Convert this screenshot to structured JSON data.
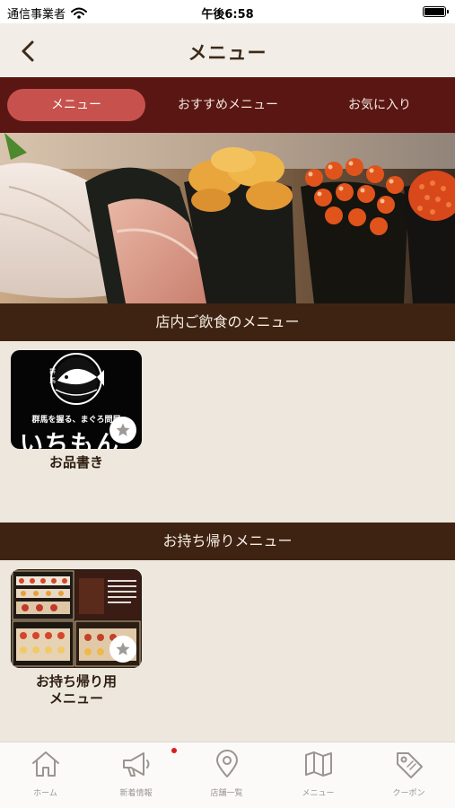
{
  "status_bar": {
    "carrier": "通信事業者",
    "time": "午後6:58"
  },
  "nav": {
    "title": "メニュー"
  },
  "segments": [
    {
      "label": "メニュー",
      "active": true
    },
    {
      "label": "おすすめメニュー",
      "active": false
    },
    {
      "label": "お気に入り",
      "active": false
    }
  ],
  "sections": [
    {
      "title": "店内ご飲食のメニュー",
      "items": [
        {
          "name": "お品書き",
          "image_text": "群馬を握る、まぐろ問屋",
          "logo_text": "いちもん"
        }
      ]
    },
    {
      "title": "お持ち帰りメニュー",
      "items": [
        {
          "name_line1": "お持ち帰り用",
          "name_line2": "メニュー"
        }
      ]
    }
  ],
  "tabs": [
    {
      "label": "ホーム",
      "icon": "home-icon"
    },
    {
      "label": "新着情報",
      "icon": "megaphone-icon",
      "badge": true
    },
    {
      "label": "店舗一覧",
      "icon": "map-pin-icon"
    },
    {
      "label": "メニュー",
      "icon": "map-icon"
    },
    {
      "label": "クーポン",
      "icon": "coupon-tag-icon"
    }
  ],
  "colors": {
    "segment_bar": "#5a1613",
    "segment_active": "#c7514c",
    "section_header": "#3f2312",
    "background": "#ede7dd",
    "badge": "#d81e1e"
  }
}
